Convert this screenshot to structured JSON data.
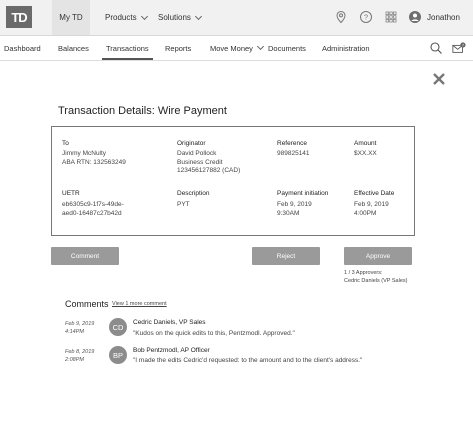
{
  "topbar": {
    "logo_text": "TD",
    "nav": [
      {
        "label": "My TD"
      },
      {
        "label": "Products"
      },
      {
        "label": "Solutions"
      }
    ],
    "icons": [
      "location-icon",
      "help-icon",
      "apps-grid-icon",
      "user-avatar-icon"
    ],
    "username": "Jonathon"
  },
  "nav2": {
    "items": [
      {
        "label": "Dashboard"
      },
      {
        "label": "Balances"
      },
      {
        "label": "Transactions"
      },
      {
        "label": "Reports"
      },
      {
        "label": "Move Money"
      },
      {
        "label": "Documents"
      },
      {
        "label": "Administration"
      }
    ],
    "active": "Transactions",
    "notification_count": "7"
  },
  "modal": {
    "title": "Transaction Details: Wire Payment",
    "fields": {
      "to": {
        "label": "To",
        "value": "Jimmy McNulty\nABA RTN: 132563249"
      },
      "originator": {
        "label": "Originator",
        "value": "David Pollock\nBusiness Credit\n123456127882 (CAD)"
      },
      "reference": {
        "label": "Reference",
        "value": "989825141"
      },
      "amount": {
        "label": "Amount",
        "value": "$XX.XX"
      },
      "uetr": {
        "label": "UETR",
        "value": "eb6305c9-1f7s-49de-\naed0-16487c27b42d"
      },
      "description": {
        "label": "Description",
        "value": "PYT"
      },
      "payment_initiation": {
        "label": "Payment initiation",
        "value": "Feb 9, 2019\n9:30AM"
      },
      "effective_date": {
        "label": "Effective Date",
        "value": "Feb 9, 2019\n4:00PM"
      }
    },
    "buttons": {
      "comment": "Comment",
      "reject": "Reject",
      "approve": "Approve"
    },
    "approvers": {
      "count": "1 / 3 Approvers:",
      "names": "Cedric Daniels (VP Sales)"
    }
  },
  "comments": {
    "title": "Comments",
    "view_more": "View 1 more comment",
    "items": [
      {
        "date": "Feb 9, 2019",
        "time": "4:14PM",
        "initials": "CD",
        "author": "Cedric Daniels, VP Sales",
        "text": "\"Kudos on the quick edits to this, Pentzmodl. Approved.\""
      },
      {
        "date": "Feb 8, 2019",
        "time": "2:08PM",
        "initials": "BP",
        "author": "Bob Pentzmodl, AP Officer",
        "text": "\"I made the edits Cedric'd requested: to the amount and to the client's address.\""
      }
    ]
  },
  "colors": {
    "button_gray": "#9a9a9a",
    "avatar_gray": "#8c8c8c",
    "topbar_bg": "#f1f1f1"
  }
}
